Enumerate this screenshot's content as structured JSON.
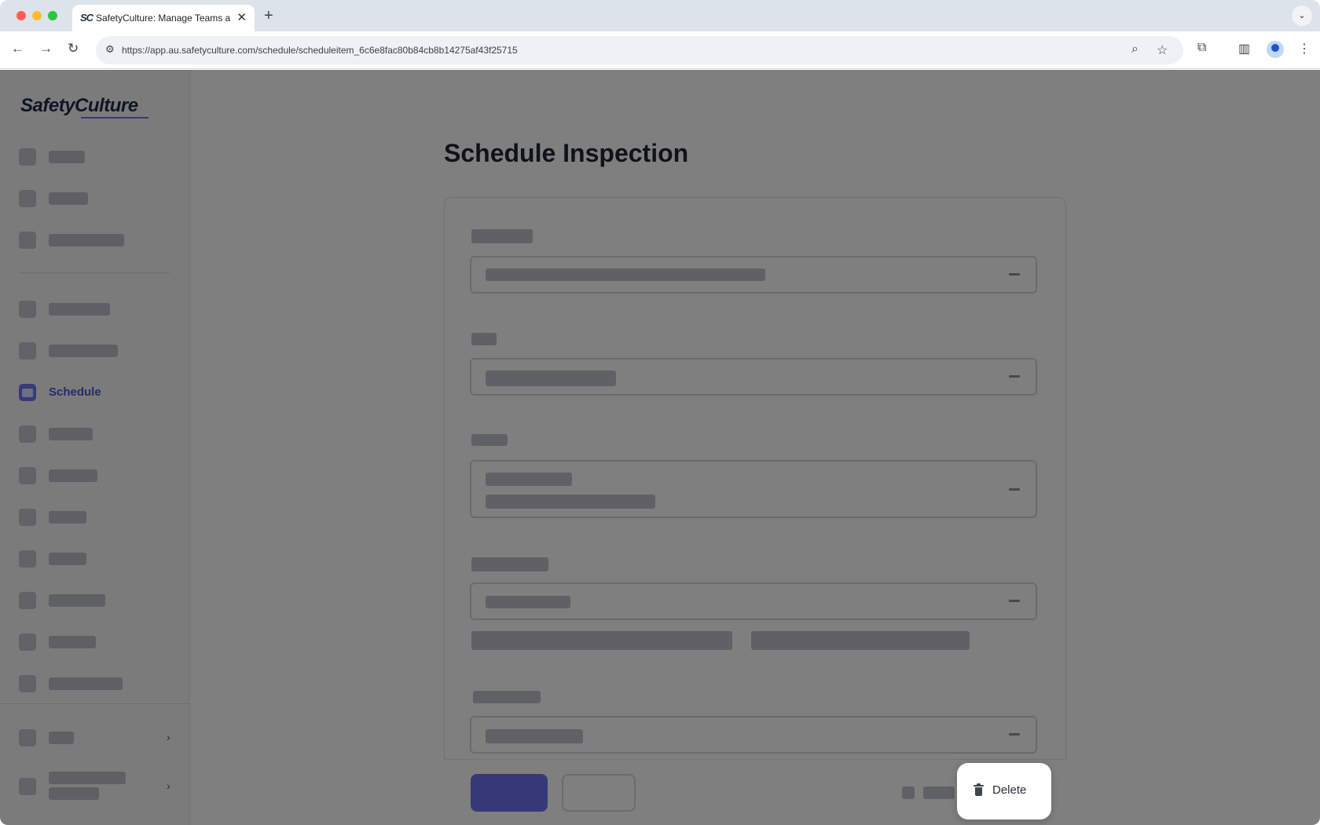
{
  "browser": {
    "tab_title": "SafetyCulture: Manage Teams and...",
    "tab_favicon_text": "SC",
    "url": "https://app.au.safetyculture.com/schedule/scheduleitem_6c6e8fac80b84cb8b14275af43f25715"
  },
  "sidebar": {
    "logo_text": "SafetyCulture",
    "active_item_label": "Schedule"
  },
  "main": {
    "page_title": "Schedule Inspection"
  },
  "popup": {
    "delete_label": "Delete"
  },
  "colors": {
    "accent": "#6e73ee",
    "active_nav_text": "#4f55d8",
    "overlay": "rgba(0,0,0,0.5)"
  }
}
